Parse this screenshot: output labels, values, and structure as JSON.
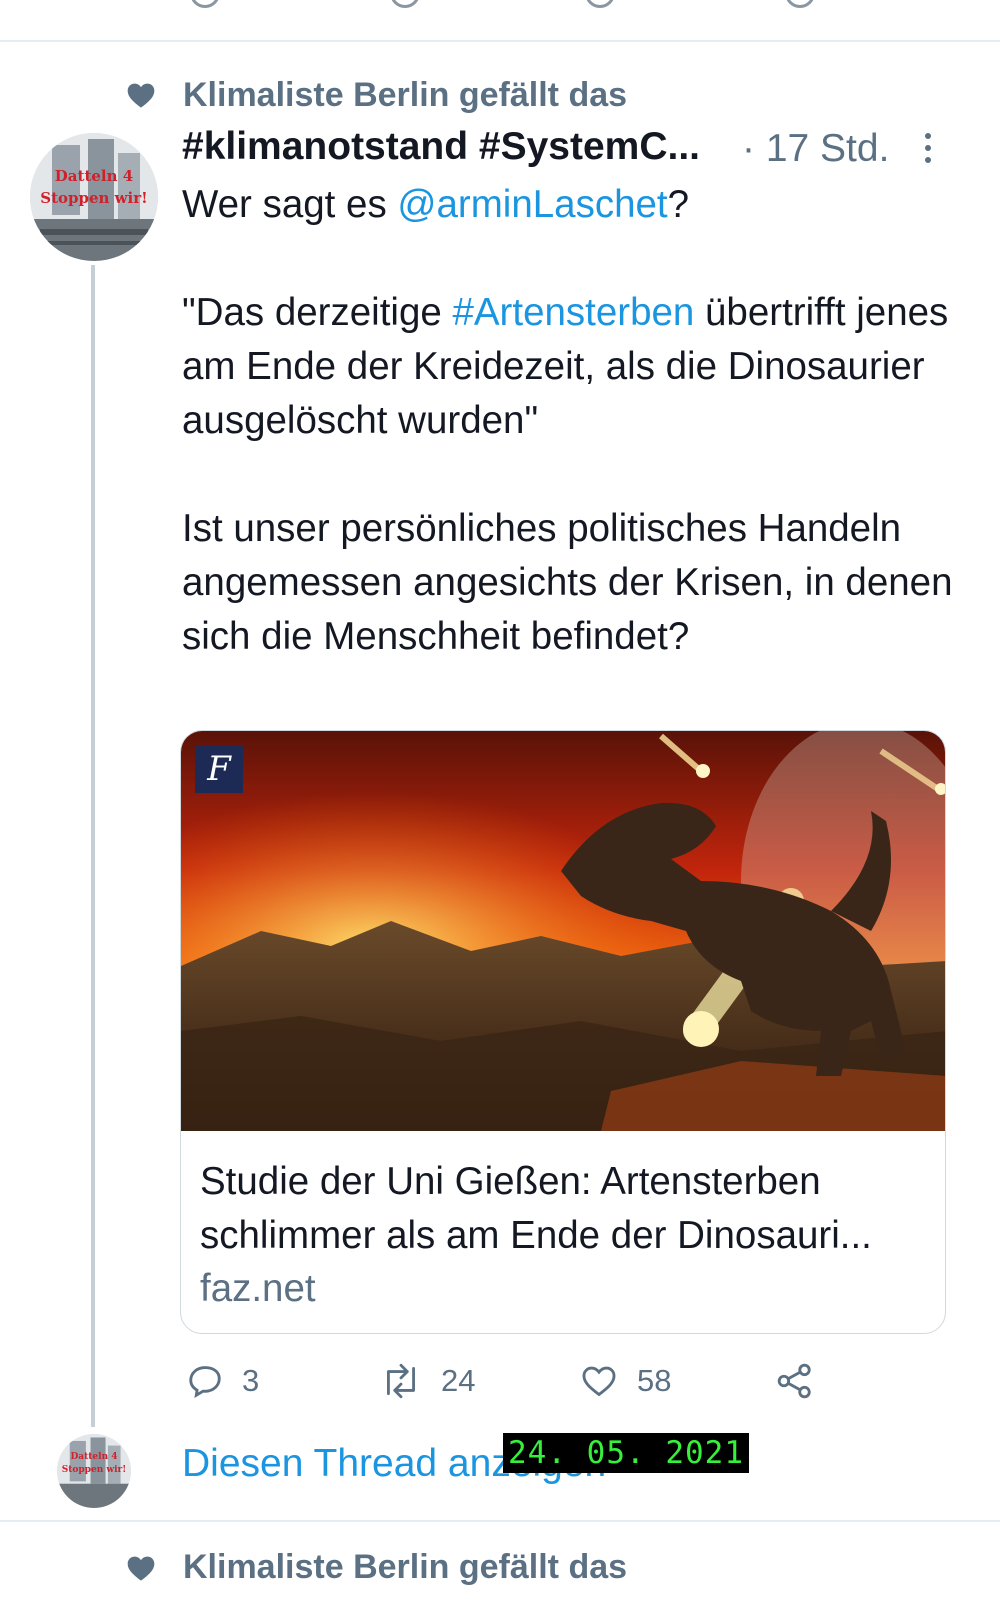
{
  "social_context": {
    "text": "Klimaliste Berlin gefällt das",
    "icon": "heart-icon"
  },
  "tweet": {
    "author": "#klimanotstand #SystemC...",
    "time": "· 17 Std.",
    "avatar_text_line1": "Datteln 4",
    "avatar_text_line2": "Stoppen wir!",
    "line1_prefix": "Wer sagt es ",
    "mention": "@arminLaschet",
    "line1_suffix": "?",
    "para2_prefix": "\"Das derzeitige ",
    "hashtag": "#Artensterben",
    "para2_suffix": " übertrifft jenes am Ende der Kreidezeit, als die Dinosaurier ausgelöscht wurden\"",
    "para3": "Ist unser persönliches politisches Handeln angemessen angesichts der Krisen, in denen sich die Menschheit befindet?"
  },
  "card": {
    "badge": "F",
    "title": "Studie der Uni Gießen: Artensterben schlimmer als am Ende der Dinosauri...",
    "domain": "faz.net"
  },
  "actions": {
    "replies": "3",
    "retweets": "24",
    "likes": "58"
  },
  "show_thread": "Diesen Thread anzeigen",
  "date_stamp": "24. 05. 2021",
  "next_social_context": {
    "text": "Klimaliste Berlin gefällt das"
  },
  "colors": {
    "link": "#1b95e0",
    "secondary": "#5b7083",
    "stamp_text": "#36f03c"
  }
}
